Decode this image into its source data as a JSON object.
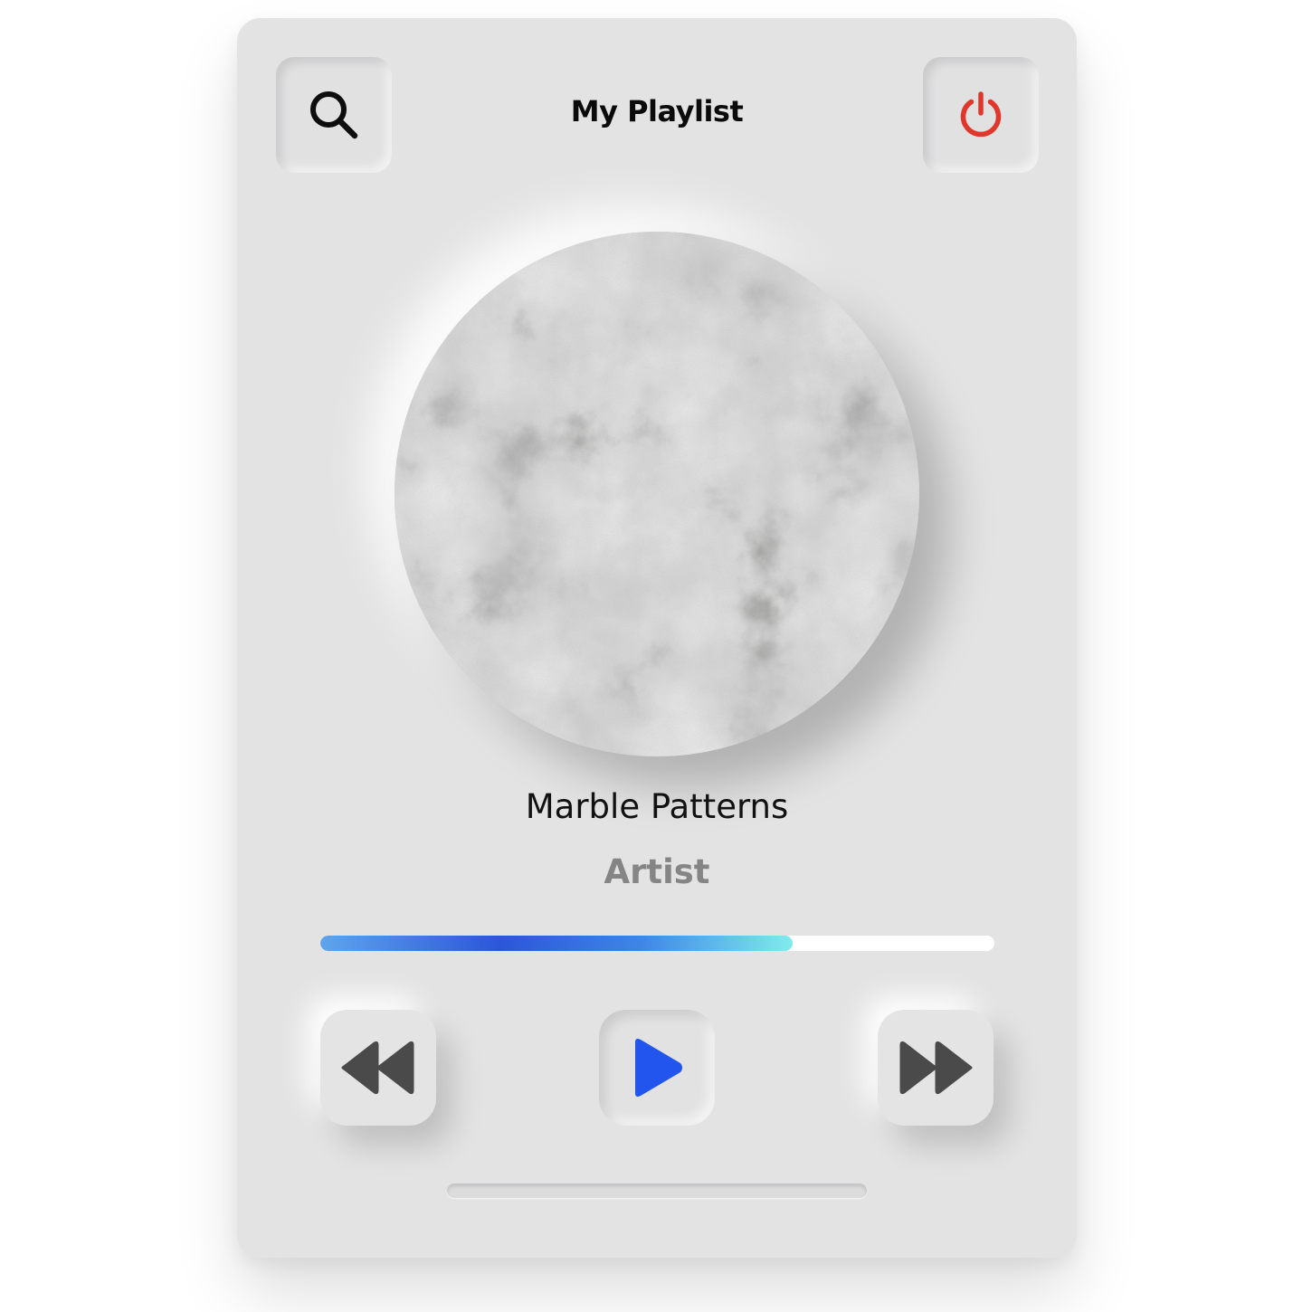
{
  "header": {
    "title": "My Playlist",
    "search_icon": "search-icon",
    "power_icon": "power-icon",
    "power_color": "#e0372d"
  },
  "now_playing": {
    "artwork": "marble-texture-artwork",
    "song_title": "Marble Patterns",
    "artist": "Artist"
  },
  "progress": {
    "fraction": 0.7
  },
  "controls": {
    "rewind_icon": "rewind-icon",
    "play_icon": "play-icon",
    "fast_forward_icon": "fast-forward-icon",
    "play_color": "#2255ee",
    "icon_color": "#4a4a4a"
  }
}
